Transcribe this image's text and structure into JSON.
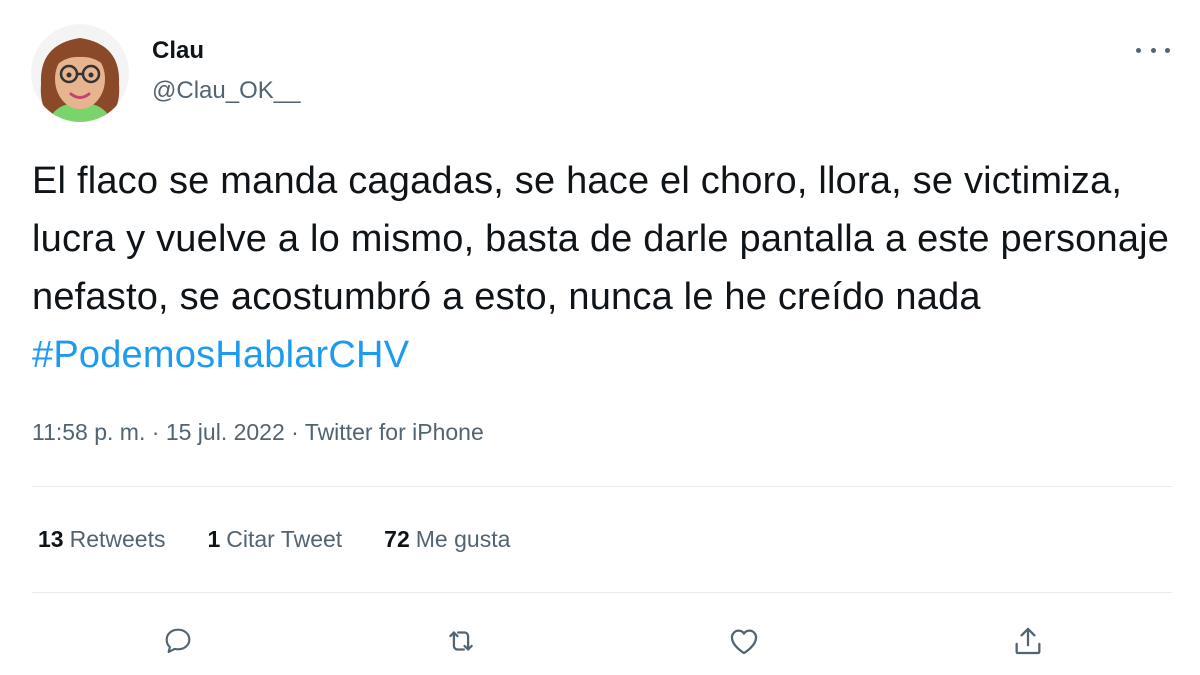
{
  "author": {
    "name": "Clau",
    "handle": "@Clau_OK__"
  },
  "tweet": {
    "text": "El flaco se manda cagadas, se hace el choro, llora, se victimiza, lucra y vuelve a lo mismo, basta de darle pantalla a este personaje nefasto, se acostumbró a esto, nunca le he creído nada ",
    "hashtag": "#PodemosHablarCHV"
  },
  "meta": {
    "time": "11:58 p. m.",
    "separator": " · ",
    "date": "15 jul. 2022",
    "source": "Twitter for iPhone"
  },
  "stats": {
    "retweets_count": "13",
    "retweets_label": "Retweets",
    "quotes_count": "1",
    "quotes_label": "Citar Tweet",
    "likes_count": "72",
    "likes_label": "Me gusta"
  },
  "actions": {
    "icons": [
      "reply-icon",
      "retweet-icon",
      "like-icon",
      "share-icon"
    ],
    "icon_color": "#536471"
  },
  "colors": {
    "text": "#0f1419",
    "secondary": "#536471",
    "accent": "#1d9bf0",
    "divider": "#e6ecf0"
  }
}
